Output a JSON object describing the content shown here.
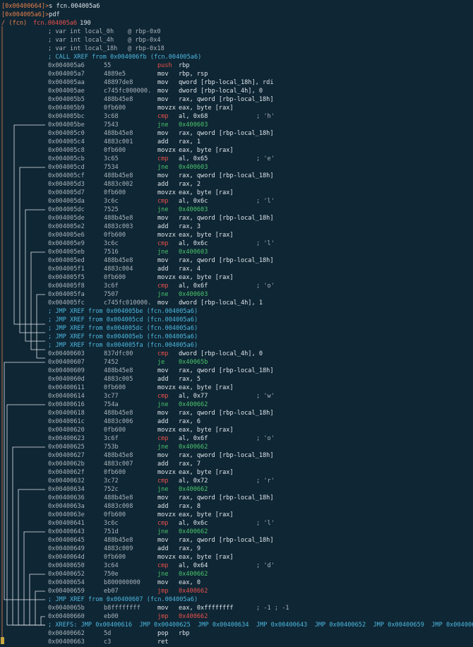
{
  "prompt_lines": [
    {
      "addr": "[0x00400664]>",
      "cmd": " s fcn.004005a6"
    },
    {
      "addr": "[0x004005a6]>",
      "cmd": " pdf"
    }
  ],
  "function_header": {
    "prefix": "/ (fcn) ",
    "name": "fcn.004005a6",
    "size": " 190"
  },
  "vars": [
    {
      "text": "; var int local_0h",
      "loc": "@ rbp-0x0"
    },
    {
      "text": "; var int local_4h",
      "loc": "@ rbp-0x4"
    },
    {
      "text": "; var int local_18h",
      "loc": "@ rbp-0x18"
    }
  ],
  "xref_call": "; CALL XREF from 0x004006fb (fcn.004005a6)",
  "block1": [
    {
      "addr": "0x004005a6",
      "bytes": "55",
      "op": "push",
      "args": "rbp",
      "k": "push"
    },
    {
      "addr": "0x004005a7",
      "bytes": "4889e5",
      "op": "mov",
      "args": "rbp, rsp",
      "k": "n"
    },
    {
      "addr": "0x004005aa",
      "bytes": "48897de8",
      "op": "mov",
      "args": "qword [rbp-local_18h], rdi",
      "k": "n"
    },
    {
      "addr": "0x004005ae",
      "bytes": "c745fc000000.",
      "op": "mov",
      "args": "dword [rbp-local_4h], 0",
      "k": "n"
    },
    {
      "addr": "0x004005b5",
      "bytes": "488b45e8",
      "op": "mov",
      "args": "rax, qword [rbp-local_18h]",
      "k": "n"
    },
    {
      "addr": "0x004005b9",
      "bytes": "0fb600",
      "op": "movzx",
      "args": "eax, byte [rax]",
      "k": "n"
    },
    {
      "addr": "0x004005bc",
      "bytes": "3c68",
      "op": "cmp",
      "args": "al, 0x68",
      "cm": "; 'h'",
      "k": "cmp"
    },
    {
      "addr": "0x004005be",
      "bytes": "7543",
      "op": "jne",
      "args": "0x400603",
      "k": "jmp"
    },
    {
      "addr": "0x004005c0",
      "bytes": "488b45e8",
      "op": "mov",
      "args": "rax, qword [rbp-local_18h]",
      "k": "n"
    },
    {
      "addr": "0x004005c4",
      "bytes": "4883c001",
      "op": "add",
      "args": "rax, 1",
      "k": "n"
    },
    {
      "addr": "0x004005c8",
      "bytes": "0fb600",
      "op": "movzx",
      "args": "eax, byte [rax]",
      "k": "n"
    },
    {
      "addr": "0x004005cb",
      "bytes": "3c65",
      "op": "cmp",
      "args": "al, 0x65",
      "cm": "; 'e'",
      "k": "cmp"
    },
    {
      "addr": "0x004005cd",
      "bytes": "7534",
      "op": "jne",
      "args": "0x400603",
      "k": "jmp"
    },
    {
      "addr": "0x004005cf",
      "bytes": "488b45e8",
      "op": "mov",
      "args": "rax, qword [rbp-local_18h]",
      "k": "n"
    },
    {
      "addr": "0x004005d3",
      "bytes": "4883c002",
      "op": "add",
      "args": "rax, 2",
      "k": "n"
    },
    {
      "addr": "0x004005d7",
      "bytes": "0fb600",
      "op": "movzx",
      "args": "eax, byte [rax]",
      "k": "n"
    },
    {
      "addr": "0x004005da",
      "bytes": "3c6c",
      "op": "cmp",
      "args": "al, 0x6c",
      "cm": "; 'l'",
      "k": "cmp"
    },
    {
      "addr": "0x004005dc",
      "bytes": "7525",
      "op": "jne",
      "args": "0x400603",
      "k": "jmp"
    },
    {
      "addr": "0x004005de",
      "bytes": "488b45e8",
      "op": "mov",
      "args": "rax, qword [rbp-local_18h]",
      "k": "n"
    },
    {
      "addr": "0x004005e2",
      "bytes": "4883c003",
      "op": "add",
      "args": "rax, 3",
      "k": "n"
    },
    {
      "addr": "0x004005e6",
      "bytes": "0fb600",
      "op": "movzx",
      "args": "eax, byte [rax]",
      "k": "n"
    },
    {
      "addr": "0x004005e9",
      "bytes": "3c6c",
      "op": "cmp",
      "args": "al, 0x6c",
      "cm": "; 'l'",
      "k": "cmp"
    },
    {
      "addr": "0x004005eb",
      "bytes": "7516",
      "op": "jne",
      "args": "0x400603",
      "k": "jmp"
    },
    {
      "addr": "0x004005ed",
      "bytes": "488b45e8",
      "op": "mov",
      "args": "rax, qword [rbp-local_18h]",
      "k": "n"
    },
    {
      "addr": "0x004005f1",
      "bytes": "4883c004",
      "op": "add",
      "args": "rax, 4",
      "k": "n"
    },
    {
      "addr": "0x004005f5",
      "bytes": "0fb600",
      "op": "movzx",
      "args": "eax, byte [rax]",
      "k": "n"
    },
    {
      "addr": "0x004005f8",
      "bytes": "3c6f",
      "op": "cmp",
      "args": "al, 0x6f",
      "cm": "; 'o'",
      "k": "cmp"
    },
    {
      "addr": "0x004005fa",
      "bytes": "7507",
      "op": "jne",
      "args": "0x400603",
      "k": "jmp"
    },
    {
      "addr": "0x004005fc",
      "bytes": "c745fc010000.",
      "op": "mov",
      "args": "dword [rbp-local_4h], 1",
      "k": "n"
    }
  ],
  "jmp_xrefs": [
    "; JMP XREF from 0x004005be (fcn.004005a6)",
    "; JMP XREF from 0x004005cd (fcn.004005a6)",
    "; JMP XREF from 0x004005dc (fcn.004005a6)",
    "; JMP XREF from 0x004005eb (fcn.004005a6)",
    "; JMP XREF from 0x004005fa (fcn.004005a6)"
  ],
  "block2": [
    {
      "addr": "0x00400603",
      "bytes": "837dfc00",
      "op": "cmp",
      "args": "dword [rbp-local_4h], 0",
      "k": "cmp"
    },
    {
      "addr": "0x00400607",
      "bytes": "7452",
      "op": "je",
      "args": "0x40065b",
      "k": "jmp"
    },
    {
      "addr": "0x00400609",
      "bytes": "488b45e8",
      "op": "mov",
      "args": "rax, qword [rbp-local_18h]",
      "k": "n"
    },
    {
      "addr": "0x0040060d",
      "bytes": "4883c005",
      "op": "add",
      "args": "rax, 5",
      "k": "n"
    },
    {
      "addr": "0x00400611",
      "bytes": "0fb600",
      "op": "movzx",
      "args": "eax, byte [rax]",
      "k": "n"
    },
    {
      "addr": "0x00400614",
      "bytes": "3c77",
      "op": "cmp",
      "args": "al, 0x77",
      "cm": "; 'w'",
      "k": "cmp"
    },
    {
      "addr": "0x00400616",
      "bytes": "754a",
      "op": "jne",
      "args": "0x400662",
      "k": "jmp"
    },
    {
      "addr": "0x00400618",
      "bytes": "488b45e8",
      "op": "mov",
      "args": "rax, qword [rbp-local_18h]",
      "k": "n"
    },
    {
      "addr": "0x0040061c",
      "bytes": "4883c006",
      "op": "add",
      "args": "rax, 6",
      "k": "n"
    },
    {
      "addr": "0x00400620",
      "bytes": "0fb600",
      "op": "movzx",
      "args": "eax, byte [rax]",
      "k": "n"
    },
    {
      "addr": "0x00400623",
      "bytes": "3c6f",
      "op": "cmp",
      "args": "al, 0x6f",
      "cm": "; 'o'",
      "k": "cmp"
    },
    {
      "addr": "0x00400625",
      "bytes": "753b",
      "op": "jne",
      "args": "0x400662",
      "k": "jmp"
    },
    {
      "addr": "0x00400627",
      "bytes": "488b45e8",
      "op": "mov",
      "args": "rax, qword [rbp-local_18h]",
      "k": "n"
    },
    {
      "addr": "0x0040062b",
      "bytes": "4883c007",
      "op": "add",
      "args": "rax, 7",
      "k": "n"
    },
    {
      "addr": "0x0040062f",
      "bytes": "0fb600",
      "op": "movzx",
      "args": "eax, byte [rax]",
      "k": "n"
    },
    {
      "addr": "0x00400632",
      "bytes": "3c72",
      "op": "cmp",
      "args": "al, 0x72",
      "cm": "; 'r'",
      "k": "cmp"
    },
    {
      "addr": "0x00400634",
      "bytes": "752c",
      "op": "jne",
      "args": "0x400662",
      "k": "jmp"
    },
    {
      "addr": "0x00400636",
      "bytes": "488b45e8",
      "op": "mov",
      "args": "rax, qword [rbp-local_18h]",
      "k": "n"
    },
    {
      "addr": "0x0040063a",
      "bytes": "4883c008",
      "op": "add",
      "args": "rax, 8",
      "k": "n"
    },
    {
      "addr": "0x0040063e",
      "bytes": "0fb600",
      "op": "movzx",
      "args": "eax, byte [rax]",
      "k": "n"
    },
    {
      "addr": "0x00400641",
      "bytes": "3c6c",
      "op": "cmp",
      "args": "al, 0x6c",
      "cm": "; 'l'",
      "k": "cmp"
    },
    {
      "addr": "0x00400643",
      "bytes": "751d",
      "op": "jne",
      "args": "0x400662",
      "k": "jmp"
    },
    {
      "addr": "0x00400645",
      "bytes": "488b45e8",
      "op": "mov",
      "args": "rax, qword [rbp-local_18h]",
      "k": "n"
    },
    {
      "addr": "0x00400649",
      "bytes": "4883c009",
      "op": "add",
      "args": "rax, 9",
      "k": "n"
    },
    {
      "addr": "0x0040064d",
      "bytes": "0fb600",
      "op": "movzx",
      "args": "eax, byte [rax]",
      "k": "n"
    },
    {
      "addr": "0x00400650",
      "bytes": "3c64",
      "op": "cmp",
      "args": "al, 0x64",
      "cm": "; 'd'",
      "k": "cmp"
    },
    {
      "addr": "0x00400652",
      "bytes": "750e",
      "op": "jne",
      "args": "0x400662",
      "k": "jmp"
    },
    {
      "addr": "0x00400654",
      "bytes": "b800000000",
      "op": "mov",
      "args": "eax, 0",
      "k": "n"
    },
    {
      "addr": "0x00400659",
      "bytes": "eb07",
      "op": "jmp",
      "args": "0x400662",
      "k": "jmp"
    }
  ],
  "jmp_xref_2": "; JMP XREF from 0x00400607 (fcn.004005a6)",
  "block3": [
    {
      "addr": "0x0040065b",
      "bytes": "b8ffffffff",
      "op": "mov",
      "args": "eax, 0xffffffff",
      "cm": "; -1 ; -1",
      "k": "n"
    },
    {
      "addr": "0x00400660",
      "bytes": "eb00",
      "op": "jmp",
      "args": "0x400662",
      "k": "jmp"
    }
  ],
  "xrefs_line": "; XREFS: JMP 0x00400616  JMP 0x00400625  JMP 0x00400634  JMP 0x00400643  JMP 0x00400652  JMP 0x00400659  JMP 0x00400660",
  "block4": [
    {
      "addr": "0x00400662",
      "bytes": "5d",
      "op": "pop",
      "args": "rbp",
      "k": "n"
    },
    {
      "addr": "0x00400663",
      "bytes": "c3",
      "op": "ret",
      "args": "",
      "k": "n"
    }
  ],
  "colors": {
    "background": "#0f2634",
    "address": "#c8d0d8",
    "prompt": "#e8804a",
    "mnemonic_special": "#e8504a",
    "jump_target": "#49c56c",
    "xref": "#4cb8e0",
    "arrows": "#dfe6eb"
  }
}
